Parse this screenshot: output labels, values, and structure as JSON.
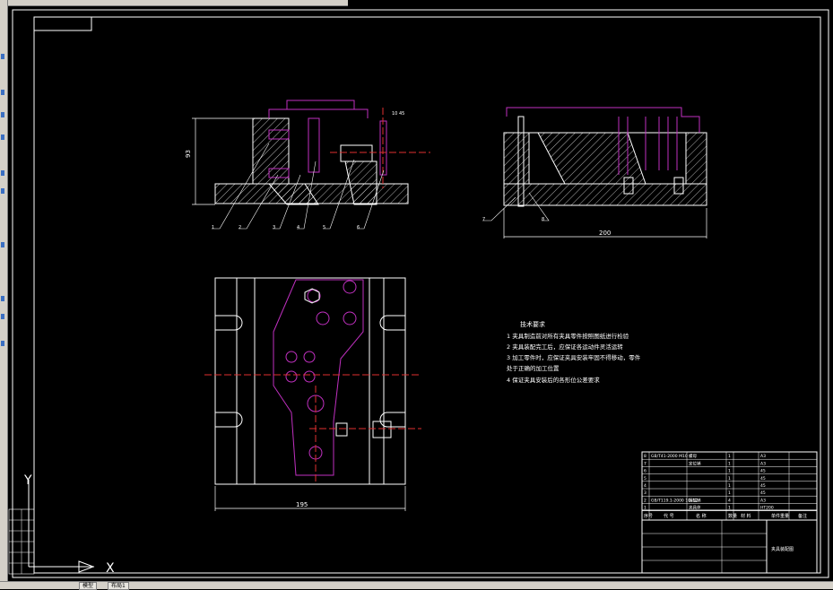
{
  "app": {
    "status_tabs": [
      "模型",
      "布局1"
    ]
  },
  "colors": {
    "background": "#000000",
    "outline": "#ffffff",
    "hidden_parts": "#c030c0",
    "centerline": "#e03030",
    "hatch": "#ffffff"
  },
  "front_view": {
    "dim_height": "93",
    "dim_top_right": "10 45",
    "leaders": [
      "1",
      "2",
      "3",
      "4",
      "5",
      "6"
    ]
  },
  "side_view": {
    "dim_width": "200",
    "leaders": [
      "7",
      "8"
    ]
  },
  "top_view": {
    "dim_width": "195"
  },
  "tech_requirements": {
    "title": "技术要求",
    "items": [
      "1  夹具制造前对所有夹具零件按照图纸进行检验",
      "2  夹具装配完工后，应保证各运动件灵活运转",
      "3  加工零件时，应保证夹具安装牢固不得移动，零件",
      "    处于正确的加工位置",
      "4  保证夹具安装后的各形位公差要求"
    ]
  },
  "parts_list": {
    "rows": [
      {
        "no": "8",
        "code": "GB/T41-2000 M10",
        "name": "螺母",
        "qty": "1",
        "material": "A3",
        "note": ""
      },
      {
        "no": "7",
        "code": "",
        "name": "定位销",
        "qty": "1",
        "material": "A3",
        "note": ""
      },
      {
        "no": "6",
        "code": "",
        "name": "",
        "qty": "1",
        "material": "45",
        "note": ""
      },
      {
        "no": "5",
        "code": "",
        "name": "",
        "qty": "1",
        "material": "45",
        "note": ""
      },
      {
        "no": "4",
        "code": "",
        "name": "",
        "qty": "1",
        "material": "45",
        "note": ""
      },
      {
        "no": "3",
        "code": "",
        "name": "",
        "qty": "1",
        "material": "45",
        "note": ""
      },
      {
        "no": "2",
        "code": "GB/T119.1-2000 10x12",
        "name": "圆柱销",
        "qty": "4",
        "material": "A3",
        "note": ""
      },
      {
        "no": "1",
        "code": "",
        "name": "夹具体",
        "qty": "1",
        "material": "HT200",
        "note": ""
      }
    ],
    "header": [
      "序号",
      "代 号",
      "名 称",
      "数量",
      "材 料",
      "单件重量",
      "备注"
    ],
    "title_block_name": "夹具装配图"
  },
  "ucs": {
    "y_label": "Y",
    "x_label": "X"
  }
}
